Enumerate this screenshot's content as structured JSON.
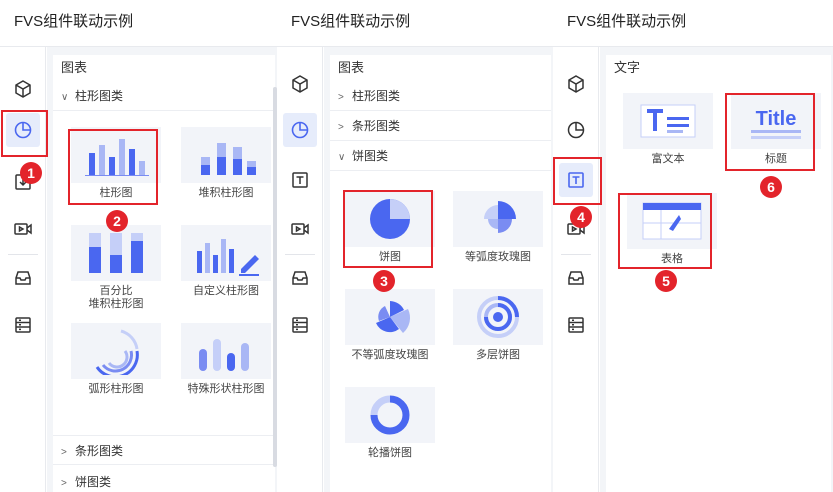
{
  "app_title": "FVS组件联动示例",
  "panel1": {
    "section": "图表",
    "group_open": "柱形图类",
    "items": [
      "柱形图",
      "堆积柱形图",
      "百分比",
      "堆积柱形图",
      "自定义柱形图",
      "弧形柱形图",
      "特殊形状柱形图"
    ],
    "group_bar": "条形图类",
    "group_pie": "饼图类"
  },
  "panel2": {
    "section": "图表",
    "group_column": "柱形图类",
    "group_bar": "条形图类",
    "group_pie": "饼图类",
    "items": [
      "饼图",
      "等弧度玫瑰图",
      "不等弧度玫瑰图",
      "多层饼图",
      "轮播饼图"
    ]
  },
  "panel3": {
    "section": "文字",
    "items": [
      "富文本",
      "标题",
      "表格"
    ],
    "title_glyph": "Title"
  },
  "badges": [
    "1",
    "2",
    "3",
    "4",
    "5",
    "6"
  ],
  "rail_icons": [
    "cube-icon",
    "pie-chart-icon",
    "text-icon",
    "video-icon",
    "inbox-icon",
    "database-icon"
  ],
  "colors": {
    "accent": "#4a67f0",
    "highlight": "#e3242b",
    "thumb_bg": "#f2f4f9"
  }
}
